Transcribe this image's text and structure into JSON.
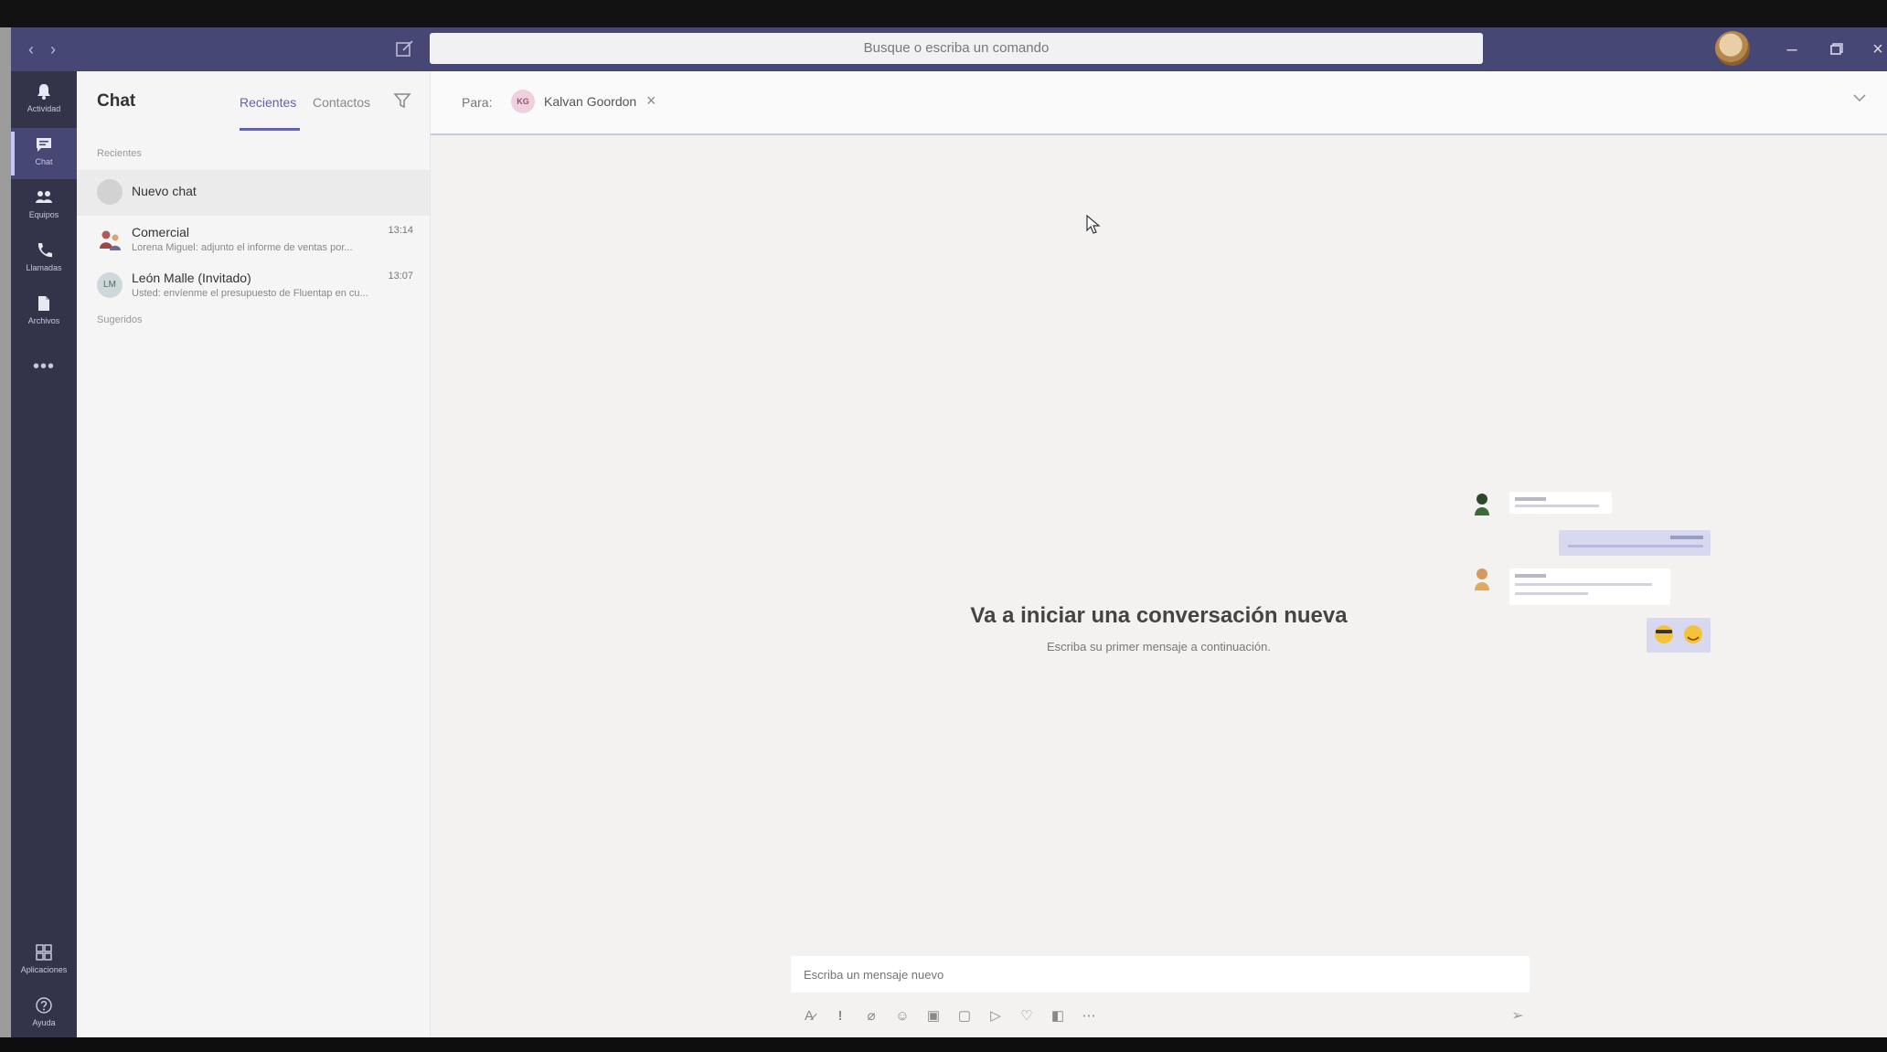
{
  "search": {
    "placeholder": "Busque o escriba un comando"
  },
  "rail": {
    "items": [
      {
        "label": "Actividad",
        "icon": "bell-icon"
      },
      {
        "label": "Chat",
        "icon": "chat-icon"
      },
      {
        "label": "Equipos",
        "icon": "teams-icon"
      },
      {
        "label": "Llamadas",
        "icon": "phone-icon"
      },
      {
        "label": "Archivos",
        "icon": "files-icon"
      }
    ],
    "more": "•••",
    "bottom": [
      {
        "label": "Aplicaciones",
        "icon": "apps-icon"
      },
      {
        "label": "Ayuda",
        "icon": "help-icon"
      }
    ]
  },
  "list": {
    "title": "Chat",
    "tabs": [
      "Recientes",
      "Contactos"
    ],
    "sections": {
      "recent": "Recientes",
      "suggested": "Sugeridos"
    },
    "chats": [
      {
        "name": "Nuevo chat",
        "initials": "",
        "time": "",
        "preview": ""
      },
      {
        "name": "Comercial",
        "initials": "",
        "time": "13:14",
        "preview": "Lorena Miguel: adjunto el informe de ventas por..."
      },
      {
        "name": "León Malle (Invitado)",
        "initials": "LM",
        "time": "13:07",
        "preview": "Usted: envíenme el presupuesto de Fluentap en cu..."
      }
    ]
  },
  "header": {
    "to_label": "Para:",
    "recipient": {
      "initials": "KG",
      "name": "Kalvan Goordon"
    }
  },
  "empty_state": {
    "title": "Va a iniciar una conversación nueva",
    "subtitle": "Escriba su primer mensaje a continuación."
  },
  "compose": {
    "placeholder": "Escriba un mensaje nuevo"
  },
  "colors": {
    "titlebar": "#464775",
    "rail": "#33344a",
    "accent": "#6264a7"
  }
}
